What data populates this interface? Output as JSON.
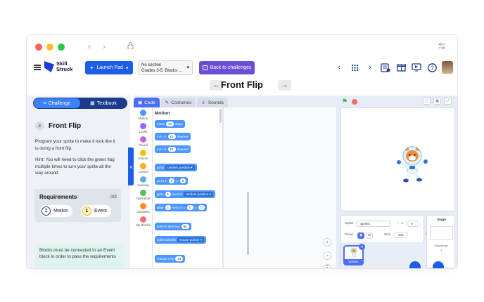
{
  "window": {
    "dots": [
      "#ff5f57",
      "#febc2e",
      "#28c840"
    ],
    "back_icon": "chevron-left-icon",
    "forward_icon": "chevron-right-icon",
    "lock_icon": "lock-icon",
    "settings_icon": "sliders-icon"
  },
  "appbar": {
    "logo_line1": "Skill",
    "logo_line2": "Struck",
    "launch_pad": "Launch Pad",
    "section_line1": "No section",
    "section_line2": "Grades 3-5: Blocks ...",
    "back_to_challenges": "Back to challenges",
    "colors": {
      "launch": "#1e5ee6",
      "back": "#6a4fd6",
      "brand": "#1f3ad6"
    }
  },
  "project": {
    "title": "Front Flip"
  },
  "left_panel": {
    "tab_challenge": "Challenge",
    "tab_textbook": "Textbook",
    "challenge_title": "Front Flip",
    "instruction": "Program your sprite to make it look like it is doing a front flip.",
    "hint": "Hint: You will need to click the green flag multiple times to turn your sprite all the way around.",
    "requirements_title": "Requirements",
    "requirements_count": "0/2",
    "requirements": [
      {
        "num": "1",
        "label": "Motion",
        "color": "#1e3a8a"
      },
      {
        "num": "1",
        "label": "Event",
        "color": "#e8b400"
      }
    ],
    "note": "Blocks must be connected to an Event block in order to pass the requirements"
  },
  "editor": {
    "tabs": [
      "Code",
      "Costumes",
      "Sounds"
    ],
    "categories": [
      {
        "label": "Motion",
        "color": "#4c97ff"
      },
      {
        "label": "Looks",
        "color": "#9966ff"
      },
      {
        "label": "Sound",
        "color": "#cf63cf"
      },
      {
        "label": "Events",
        "color": "#ffbf00"
      },
      {
        "label": "Control",
        "color": "#ffab19"
      },
      {
        "label": "Sensing",
        "color": "#5cb1d6"
      },
      {
        "label": "Operators",
        "color": "#59c059"
      },
      {
        "label": "Variables",
        "color": "#ff8c1a"
      },
      {
        "label": "My Blocks",
        "color": "#ff6680"
      }
    ],
    "palette_title": "Motion",
    "blocks": {
      "move": "move",
      "move_val": "10",
      "steps": "steps",
      "turn": "turn",
      "turn_val": "15",
      "degrees": "degrees",
      "goto": "go to",
      "random_position": "random position",
      "goto_xy": "go to x:",
      "x_val": "0",
      "y_label": "y:",
      "y_val": "0",
      "glide": "glide",
      "glide_secs": "1",
      "secs_to": "secs to",
      "glide_xy_secs_to": "secs to x:",
      "point_dir": "point in direction",
      "point_dir_val": "90",
      "point_towards": "point towards",
      "mouse_pointer": "mouse-pointer",
      "change_x": "change x by",
      "change_x_val": "10"
    }
  },
  "sprite": {
    "label_sprite": "Sprite",
    "name": "Sprite1",
    "x_label": "x",
    "x_val": "0",
    "y_label": "y",
    "y_val": "0",
    "show_label": "Show",
    "size_label": "Size",
    "size_val": "100",
    "direction_label": "Direction",
    "direction_val": "90",
    "card_name": "Sprite1"
  },
  "stage_panel": {
    "title": "Stage",
    "backdrops_label": "Backdrops",
    "backdrops_count": "1"
  }
}
